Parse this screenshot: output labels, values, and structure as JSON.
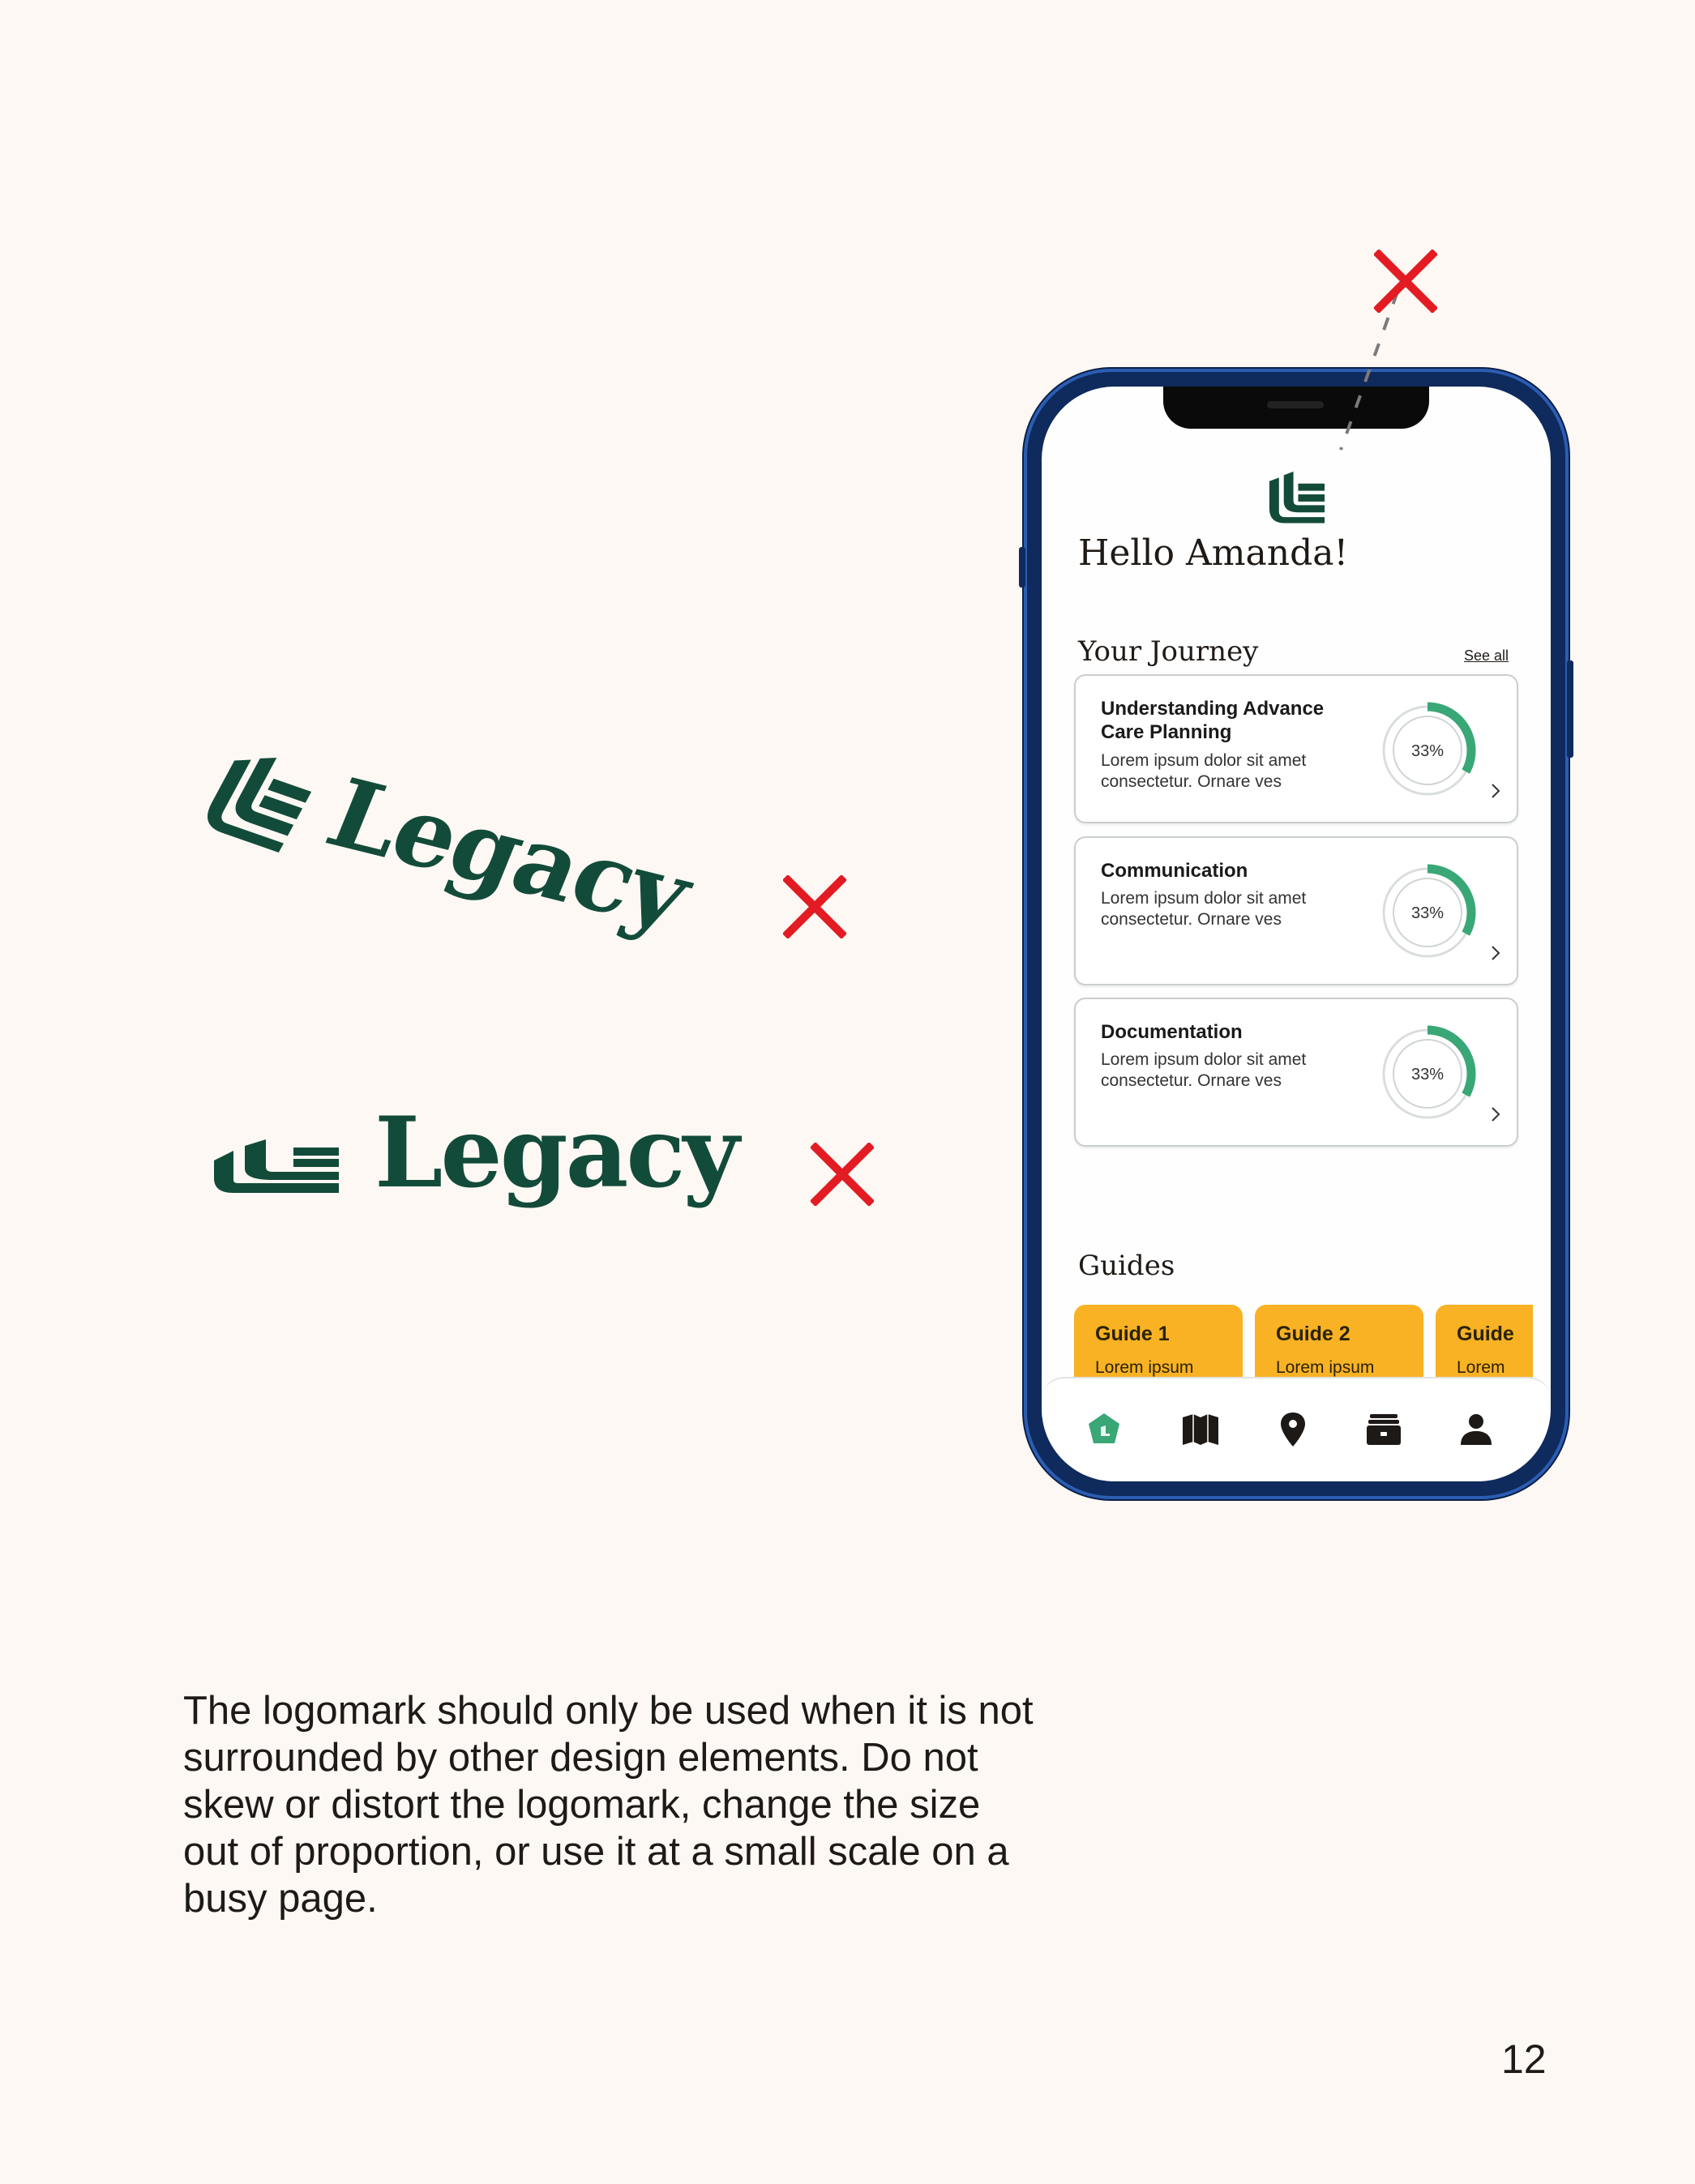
{
  "colors": {
    "brand_green": "#134b3a",
    "accent_green": "#3aa776",
    "error_red": "#e31b23",
    "guide_yellow": "#f8b223",
    "page_bg": "#fdf8f3"
  },
  "examples": {
    "skewed_wordmark": "Legacy",
    "stretched_wordmark": "Legacy"
  },
  "phone": {
    "greeting": "Hello Amanda!",
    "journey": {
      "title": "Your Journey",
      "see_all": "See all",
      "cards": [
        {
          "title": "Understanding Advance Care Planning",
          "body": "Lorem ipsum dolor sit amet consectetur. Ornare ves",
          "progress_label": "33%",
          "progress": 0.33
        },
        {
          "title": "Communication",
          "body": "Lorem ipsum dolor sit amet consectetur. Ornare ves",
          "progress_label": "33%",
          "progress": 0.33
        },
        {
          "title": "Documentation",
          "body": "Lorem ipsum dolor sit amet consectetur. Ornare ves",
          "progress_label": "33%",
          "progress": 0.33
        }
      ]
    },
    "guides": {
      "title": "Guides",
      "items": [
        {
          "title": "Guide 1",
          "subtitle": "Lorem ipsum"
        },
        {
          "title": "Guide 2",
          "subtitle": "Lorem ipsum"
        },
        {
          "title": "Guide",
          "subtitle": "Lorem"
        }
      ]
    },
    "tabs": [
      "home-icon",
      "map-icon",
      "location-pin-icon",
      "archive-box-icon",
      "profile-icon"
    ]
  },
  "body_text": "The logomark should only be used when it is not surrounded by other design elements. Do not skew or distort the logomark, change the size out of proportion, or use it at a small scale on a busy page.",
  "page_number": "12"
}
